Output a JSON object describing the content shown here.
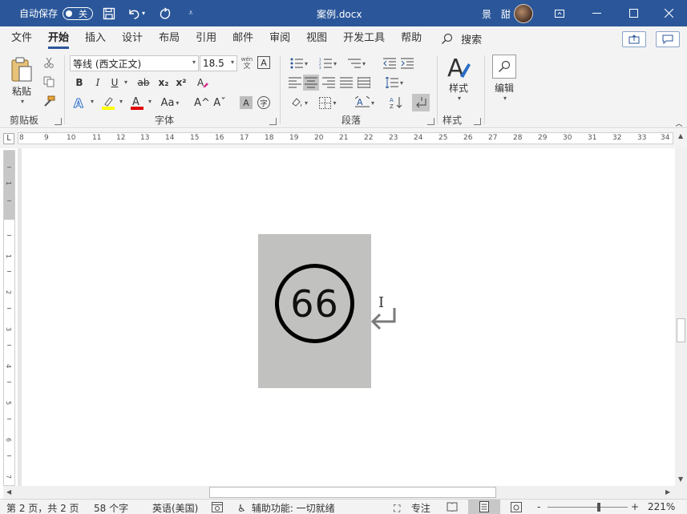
{
  "titlebar": {
    "autosave_label": "自动保存",
    "autosave_state": "关",
    "doc_title": "案例.docx",
    "user_name": "景 甜",
    "accent": "#2b579a"
  },
  "tabs": [
    "文件",
    "开始",
    "插入",
    "设计",
    "布局",
    "引用",
    "邮件",
    "审阅",
    "视图",
    "开发工具",
    "帮助"
  ],
  "active_tab": "开始",
  "search_label": "搜索",
  "ribbon": {
    "clipboard": {
      "paste_label": "粘贴",
      "group_label": "剪贴板"
    },
    "font": {
      "font_name": "等线 (西文正文)",
      "font_size": "18.5",
      "bold": "B",
      "italic": "I",
      "underline": "U",
      "strike": "ab",
      "subscript": "x₂",
      "superscript": "x²",
      "grow": "A^",
      "shrink": "Aˇ",
      "case": "Aa",
      "group_label": "字体",
      "wen_top": "wén",
      "wen_bottom": "文"
    },
    "paragraph": {
      "group_label": "段落"
    },
    "styles": {
      "label": "样式",
      "group_label": "样式"
    },
    "editing": {
      "label": "编辑"
    }
  },
  "ruler_numbers": [
    "8",
    "9",
    "10",
    "11",
    "12",
    "13",
    "14",
    "15",
    "16",
    "17",
    "18",
    "19",
    "20",
    "21",
    "22",
    "23",
    "24",
    "25",
    "26",
    "27",
    "28",
    "29",
    "30",
    "31",
    "32",
    "33",
    "34"
  ],
  "vruler_numbers": [
    "1",
    "1",
    "2",
    "3",
    "4",
    "5",
    "6",
    "7"
  ],
  "document": {
    "circle_number": "66"
  },
  "statusbar": {
    "page_info": "第 2 页，共 2 页",
    "word_count": "58 个字",
    "language": "英语(美国)",
    "accessibility": "辅助功能: 一切就绪",
    "focus": "专注",
    "zoom": "221%",
    "zoom_minus": "-",
    "zoom_plus": "+"
  }
}
